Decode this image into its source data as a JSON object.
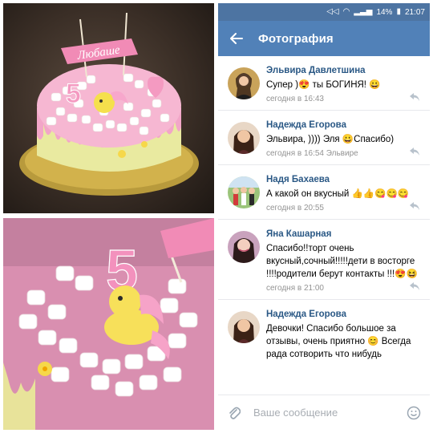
{
  "status_bar": {
    "battery": "14%",
    "time": "21:07"
  },
  "app_bar": {
    "title": "Фотография"
  },
  "composer": {
    "placeholder": "Ваше сообщение"
  },
  "photo": {
    "topper_text": "Любаше"
  },
  "comments": [
    {
      "author": "Эльвира Давлетшина",
      "text": "Супер )😍 ты БОГИНЯ! 😀",
      "meta": "сегодня в 16:43"
    },
    {
      "author": "Надежда Егорова",
      "text": "Эльвира, )))) Эля 😀Спасибо)",
      "meta": "сегодня в 16:54 Эльвире"
    },
    {
      "author": "Надя Бахаева",
      "text": "А какой он вкусный 👍👍😋😋😋",
      "meta": "сегодня в 20:55"
    },
    {
      "author": "Яна Кашарная",
      "text": "Спасибо!!торт очень вкусный,сочный!!!!!дети в восторге !!!!родители берут контакты !!!😍😆",
      "meta": "сегодня в 21:00"
    },
    {
      "author": "Надежда Егорова",
      "text": "Девочки!  Спасибо большое за отзывы,  очень приятно 😊 Всегда рада сотворить что нибудь",
      "meta": ""
    }
  ],
  "colors": {
    "vk_blue": "#5181b8",
    "status_blue": "#4d74a2",
    "author_blue": "#2a5885",
    "meta_gray": "#939393"
  }
}
